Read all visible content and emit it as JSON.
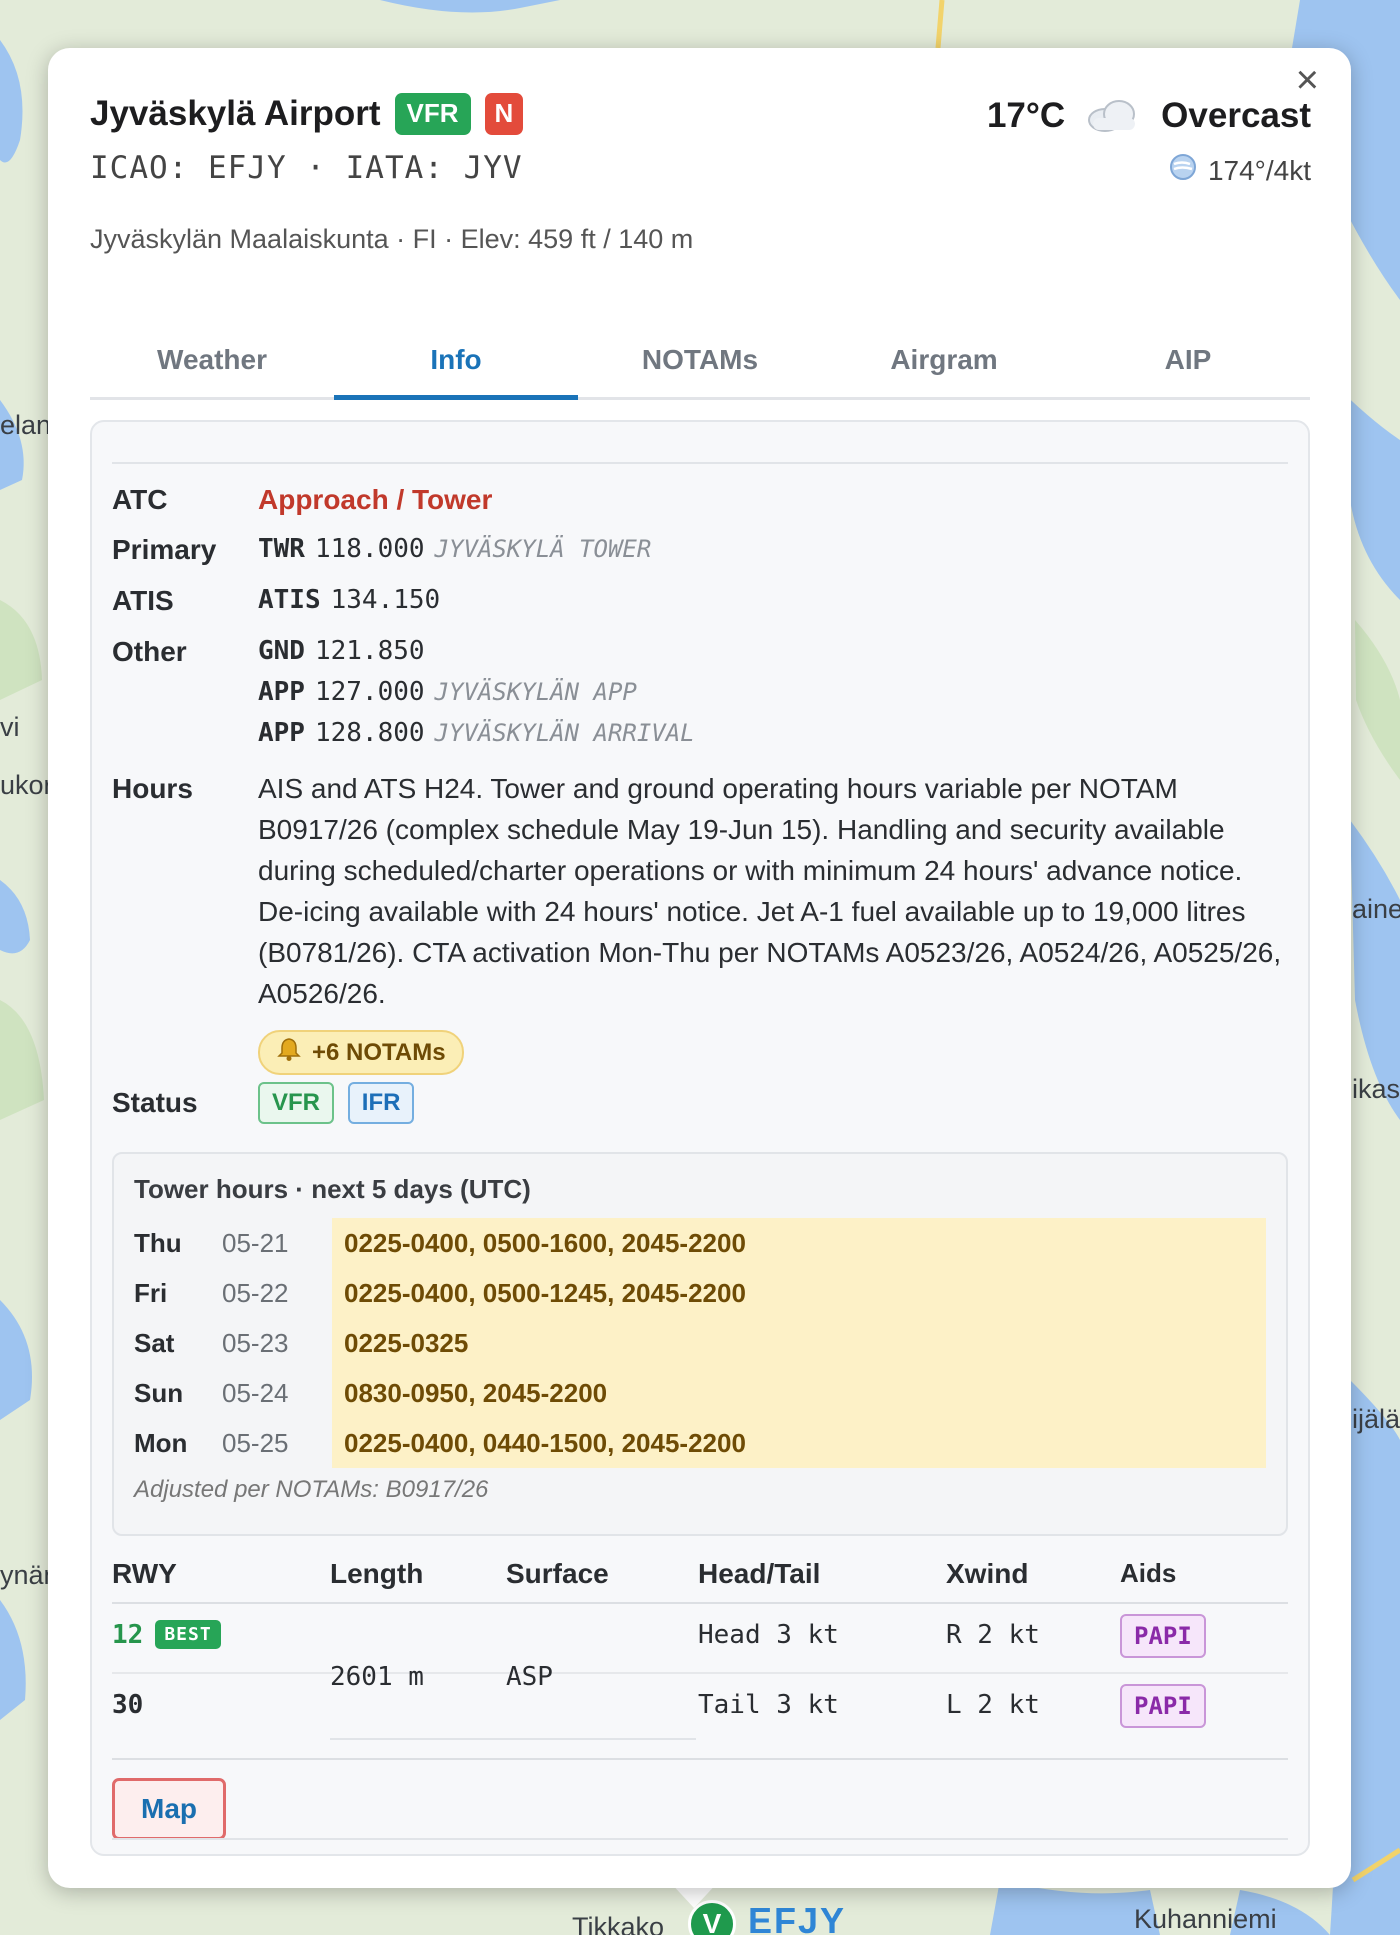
{
  "map": {
    "labels": [
      "elan",
      "vi",
      "ukor",
      "aine",
      "ikas",
      "ijälä",
      "ynäm",
      "Kuhanniemi",
      "Tikkako"
    ],
    "marker_letter": "V",
    "marker_code": "EFJY"
  },
  "airport": {
    "name": "Jyväskylä Airport",
    "flight_rules_badge": "VFR",
    "notam_badge": "N",
    "codes": "ICAO: EFJY · IATA: JYV",
    "place": "Jyväskylän Maalaiskunta · FI · Elev: 459 ft / 140 m",
    "close": "×"
  },
  "weather": {
    "temp": "17°C",
    "condition": "Overcast",
    "wind": "174°/4kt"
  },
  "tabs": [
    {
      "label": "Weather"
    },
    {
      "label": "Info"
    },
    {
      "label": "NOTAMs"
    },
    {
      "label": "Airgram"
    },
    {
      "label": "AIP"
    }
  ],
  "active_tab": "Info",
  "info": {
    "labels": {
      "atc": "ATC",
      "primary": "Primary",
      "atis": "ATIS",
      "other": "Other",
      "hours": "Hours",
      "status": "Status"
    },
    "atc": "Approach / Tower",
    "primary": {
      "type": "TWR",
      "freq": "118.000",
      "name": "JYVÄSKYLÄ TOWER"
    },
    "atis": {
      "type": "ATIS",
      "freq": "134.150"
    },
    "other": [
      {
        "type": "GND",
        "freq": "121.850",
        "name": ""
      },
      {
        "type": "APP",
        "freq": "127.000",
        "name": "JYVÄSKYLÄN APP"
      },
      {
        "type": "APP",
        "freq": "128.800",
        "name": "JYVÄSKYLÄN ARRIVAL"
      }
    ],
    "hours_text": "AIS and ATS H24. Tower and ground operating hours variable per NOTAM B0917/26 (complex schedule May 19-Jun 15). Handling and security available during scheduled/charter operations or with minimum 24 hours' advance notice. De-icing available with 24 hours' notice. Jet A-1 fuel available up to 19,000 litres (B0781/26). CTA activation Mon-Thu per NOTAMs A0523/26, A0524/26, A0525/26, A0526/26.",
    "notam_chip": "+6 NOTAMs",
    "status": [
      "VFR",
      "IFR"
    ]
  },
  "tower": {
    "title": "Tower hours · next 5 days (UTC)",
    "days": [
      {
        "day": "Thu",
        "date": "05-21",
        "hours": "0225-0400, 0500-1600, 2045-2200"
      },
      {
        "day": "Fri",
        "date": "05-22",
        "hours": "0225-0400, 0500-1245, 2045-2200"
      },
      {
        "day": "Sat",
        "date": "05-23",
        "hours": "0225-0325"
      },
      {
        "day": "Sun",
        "date": "05-24",
        "hours": "0830-0950, 2045-2200"
      },
      {
        "day": "Mon",
        "date": "05-25",
        "hours": "0225-0400, 0440-1500, 2045-2200"
      }
    ],
    "note": "Adjusted per NOTAMs: B0917/26"
  },
  "runways": {
    "headers": [
      "RWY",
      "Length",
      "Surface",
      "Head/Tail",
      "Xwind",
      "Aids"
    ],
    "length": "2601 m",
    "surface": "ASP",
    "best_label": "BEST",
    "rows": [
      {
        "rwy": "12",
        "best": true,
        "headtail": "Head 3 kt",
        "xwind": "R 2 kt",
        "aids": "PAPI"
      },
      {
        "rwy": "30",
        "best": false,
        "headtail": "Tail 3 kt",
        "xwind": "L 2 kt",
        "aids": "PAPI"
      }
    ]
  },
  "buttons": {
    "map": "Map"
  },
  "colors": {
    "vfr_green": "#27a557",
    "notam_red": "#e34b3b",
    "accent_blue": "#1a73b8",
    "atc_red": "#c1392b",
    "tower_highlight": "#fdf1c7"
  }
}
